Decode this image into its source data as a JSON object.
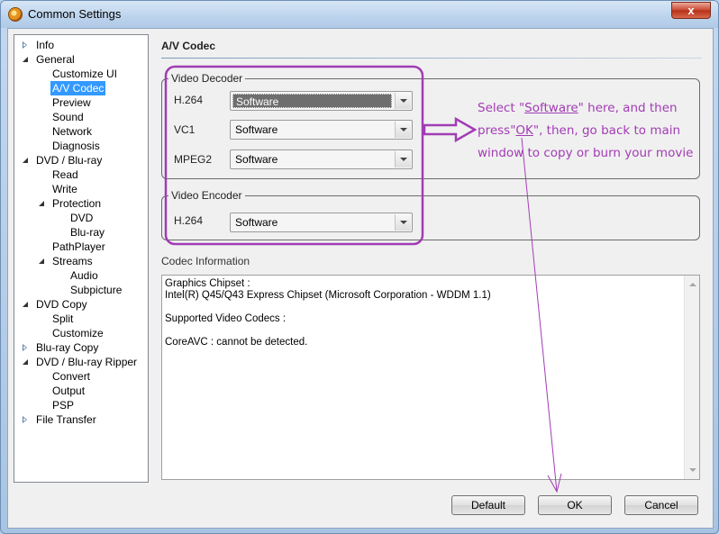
{
  "window": {
    "title": "Common Settings",
    "close_glyph": "x"
  },
  "tree": {
    "items": [
      {
        "label": "Info",
        "level": 0,
        "toggle": "collapsed"
      },
      {
        "label": "General",
        "level": 0,
        "toggle": "expanded"
      },
      {
        "label": "Customize UI",
        "level": 1,
        "toggle": "none"
      },
      {
        "label": "A/V Codec",
        "level": 1,
        "toggle": "none",
        "selected": true
      },
      {
        "label": "Preview",
        "level": 1,
        "toggle": "none"
      },
      {
        "label": "Sound",
        "level": 1,
        "toggle": "none"
      },
      {
        "label": "Network",
        "level": 1,
        "toggle": "none"
      },
      {
        "label": "Diagnosis",
        "level": 1,
        "toggle": "none"
      },
      {
        "label": "DVD / Blu-ray",
        "level": 0,
        "toggle": "expanded"
      },
      {
        "label": "Read",
        "level": 1,
        "toggle": "none"
      },
      {
        "label": "Write",
        "level": 1,
        "toggle": "none"
      },
      {
        "label": "Protection",
        "level": 1,
        "toggle": "expanded"
      },
      {
        "label": "DVD",
        "level": 2,
        "toggle": "none"
      },
      {
        "label": "Blu-ray",
        "level": 2,
        "toggle": "none"
      },
      {
        "label": "PathPlayer",
        "level": 1,
        "toggle": "none"
      },
      {
        "label": "Streams",
        "level": 1,
        "toggle": "expanded"
      },
      {
        "label": "Audio",
        "level": 2,
        "toggle": "none"
      },
      {
        "label": "Subpicture",
        "level": 2,
        "toggle": "none"
      },
      {
        "label": "DVD Copy",
        "level": 0,
        "toggle": "expanded"
      },
      {
        "label": "Split",
        "level": 1,
        "toggle": "none"
      },
      {
        "label": "Customize",
        "level": 1,
        "toggle": "none"
      },
      {
        "label": "Blu-ray Copy",
        "level": 0,
        "toggle": "collapsed"
      },
      {
        "label": "DVD / Blu-ray Ripper",
        "level": 0,
        "toggle": "expanded"
      },
      {
        "label": "Convert",
        "level": 1,
        "toggle": "none"
      },
      {
        "label": "Output",
        "level": 1,
        "toggle": "none"
      },
      {
        "label": "PSP",
        "level": 1,
        "toggle": "none"
      },
      {
        "label": "File Transfer",
        "level": 0,
        "toggle": "collapsed"
      }
    ]
  },
  "panel": {
    "title": "A/V Codec",
    "decoder": {
      "legend": "Video Decoder",
      "rows": [
        {
          "label": "H.264",
          "value": "Software"
        },
        {
          "label": "VC1",
          "value": "Software"
        },
        {
          "label": "MPEG2",
          "value": "Software"
        }
      ]
    },
    "encoder": {
      "legend": "Video Encoder",
      "rows": [
        {
          "label": "H.264",
          "value": "Software"
        }
      ]
    },
    "codec_info": {
      "label": "Codec Information",
      "lines": [
        "Graphics Chipset :",
        "Intel(R) Q45/Q43 Express Chipset (Microsoft Corporation - WDDM 1.1)",
        "",
        "Supported Video Codecs :",
        "",
        "CoreAVC : cannot be detected."
      ]
    }
  },
  "buttons": {
    "default": "Default",
    "ok": "OK",
    "cancel": "Cancel"
  },
  "annotation": {
    "part1": "Select \"",
    "software": "Software",
    "part2": "\" here, and then press\"",
    "ok": "OK",
    "part3": "\", then, go back to main window to copy or burn your movie",
    "color": "#a23cb4"
  }
}
